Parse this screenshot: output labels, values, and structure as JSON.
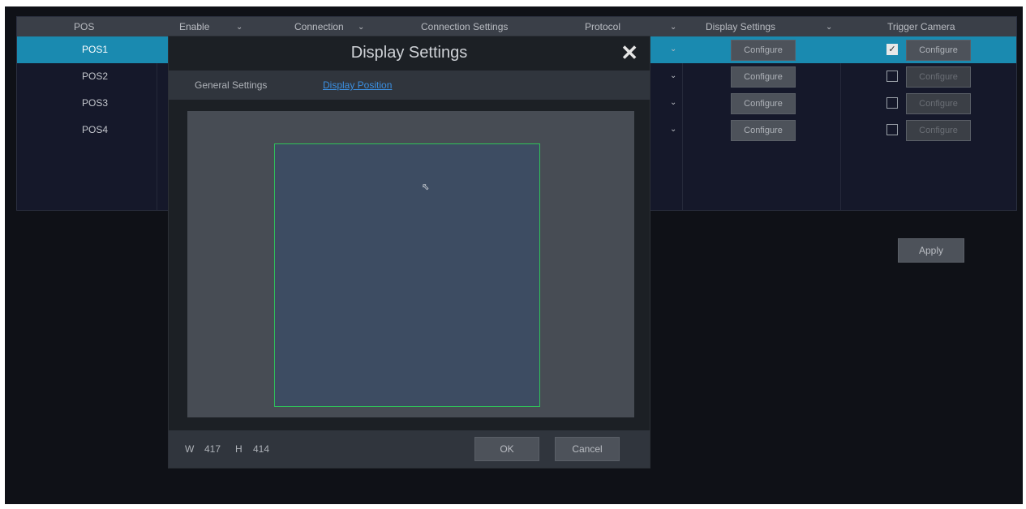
{
  "table": {
    "headers": {
      "pos": "POS",
      "enable": "Enable",
      "connection": "Connection",
      "connection_settings": "Connection Settings",
      "protocol": "Protocol",
      "display_settings": "Display Settings",
      "trigger_camera": "Trigger Camera"
    },
    "rows": [
      {
        "name": "POS1",
        "selected": true,
        "config": "Configure",
        "trigger_checked": true,
        "trigger_config": "Configure"
      },
      {
        "name": "POS2",
        "selected": false,
        "config": "Configure",
        "trigger_checked": false,
        "trigger_config": "Configure"
      },
      {
        "name": "POS3",
        "selected": false,
        "config": "Configure",
        "trigger_checked": false,
        "trigger_config": "Configure"
      },
      {
        "name": "POS4",
        "selected": false,
        "config": "Configure",
        "trigger_checked": false,
        "trigger_config": "Configure"
      }
    ]
  },
  "apply_label": "Apply",
  "dialog": {
    "title": "Display Settings",
    "close_glyph": "✕",
    "tabs": {
      "general": "General Settings",
      "position": "Display Position"
    },
    "footer": {
      "w_label": "W",
      "w_value": "417",
      "h_label": "H",
      "h_value": "414"
    },
    "ok_label": "OK",
    "cancel_label": "Cancel"
  },
  "colors": {
    "accent": "#1a8ab0",
    "region_border": "#2fc25a",
    "link": "#3b8fe0"
  }
}
